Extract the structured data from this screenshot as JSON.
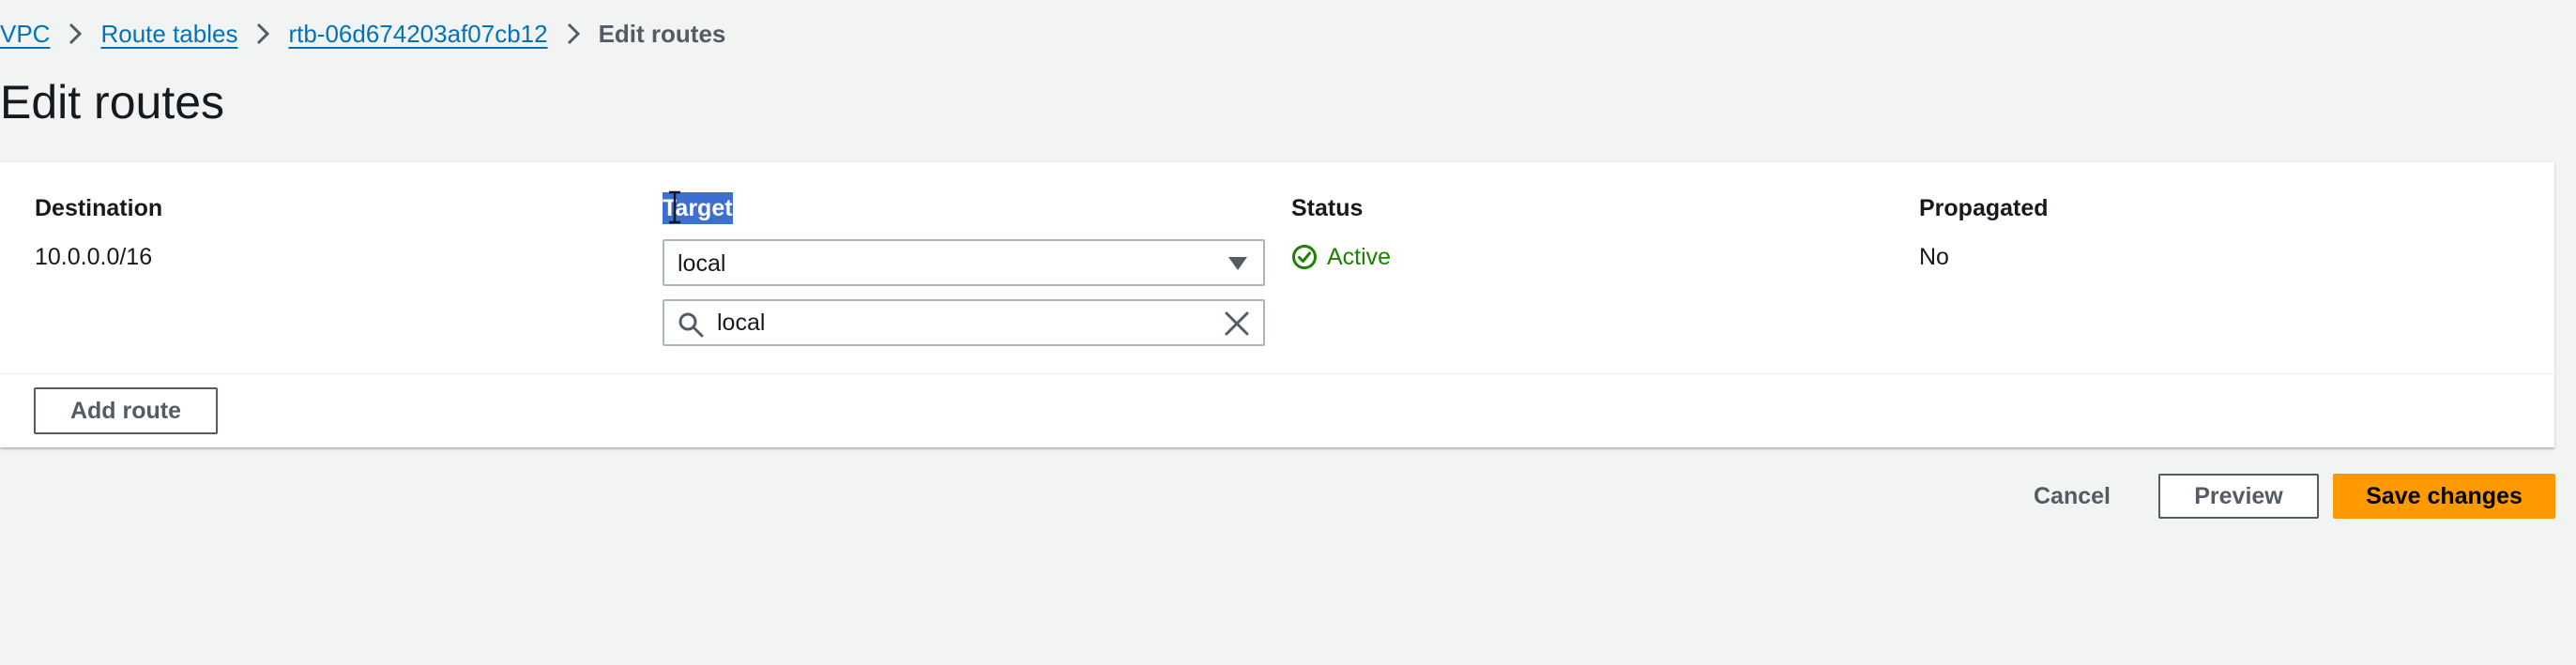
{
  "breadcrumb": {
    "items": [
      "VPC",
      "Route tables",
      "rtb-06d674203af07cb12"
    ],
    "current": "Edit routes"
  },
  "page": {
    "title": "Edit routes"
  },
  "routes_table": {
    "columns": [
      "Destination",
      "Target",
      "Status",
      "Propagated"
    ],
    "row": {
      "destination": "10.0.0.0/16",
      "target_selected": "local",
      "target_search_value": "local",
      "status": "Active",
      "propagated": "No"
    }
  },
  "actions": {
    "add_route": "Add route",
    "cancel": "Cancel",
    "preview": "Preview",
    "save": "Save changes"
  },
  "colors": {
    "link": "#0073bb",
    "status_active": "#1d8102",
    "primary_button": "#ff9900",
    "selection_highlight": "#3d6fd1"
  },
  "icons": [
    "chevron-right-icon",
    "caret-down-icon",
    "search-icon",
    "close-icon",
    "check-circle-icon",
    "text-cursor-icon"
  ]
}
